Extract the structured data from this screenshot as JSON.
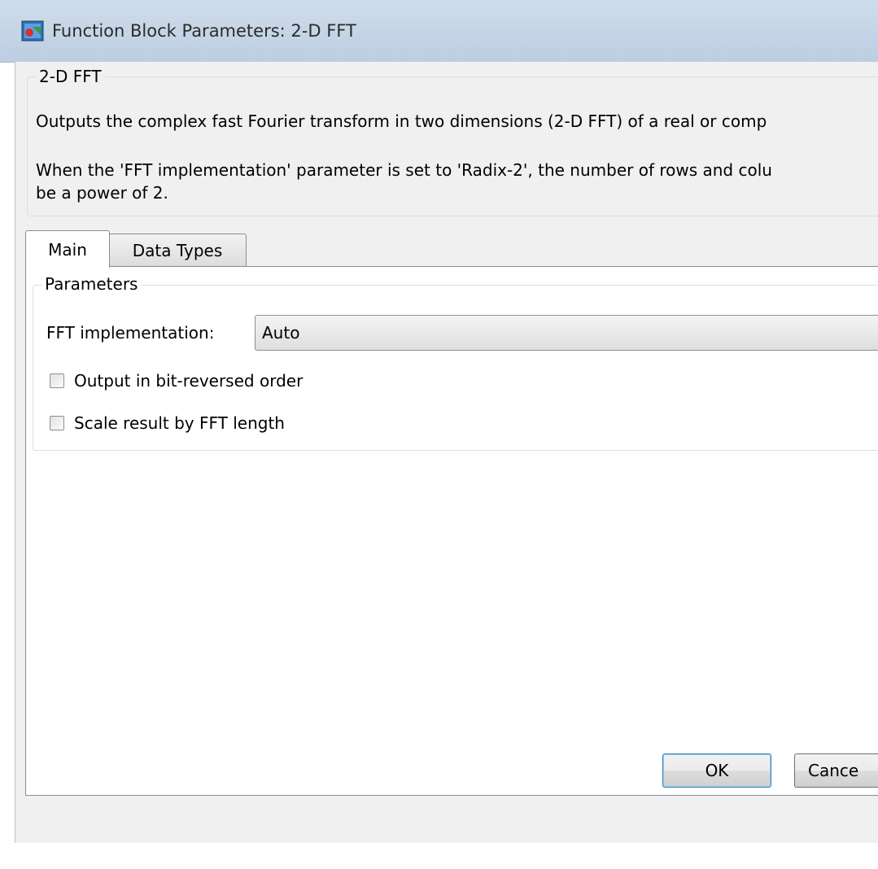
{
  "window": {
    "title": "Function Block Parameters: 2-D FFT",
    "icon": "simulink-block-icon"
  },
  "description": {
    "group_title": "2-D FFT",
    "line1": "Outputs the complex fast Fourier transform in two dimensions (2-D FFT) of a real or comp",
    "line2": "When the 'FFT implementation' parameter is set to 'Radix-2', the number of rows and colu",
    "line3": "be a power of 2."
  },
  "tabs": [
    {
      "label": "Main",
      "selected": true
    },
    {
      "label": "Data Types",
      "selected": false
    }
  ],
  "parameters": {
    "group_title": "Parameters",
    "fft_implementation": {
      "label": "FFT implementation:",
      "value": "Auto"
    },
    "checkboxes": [
      {
        "label": "Output in bit-reversed order",
        "checked": false
      },
      {
        "label": "Scale result by FFT length",
        "checked": false
      }
    ]
  },
  "buttons": {
    "ok": "OK",
    "cancel": "Cance"
  }
}
